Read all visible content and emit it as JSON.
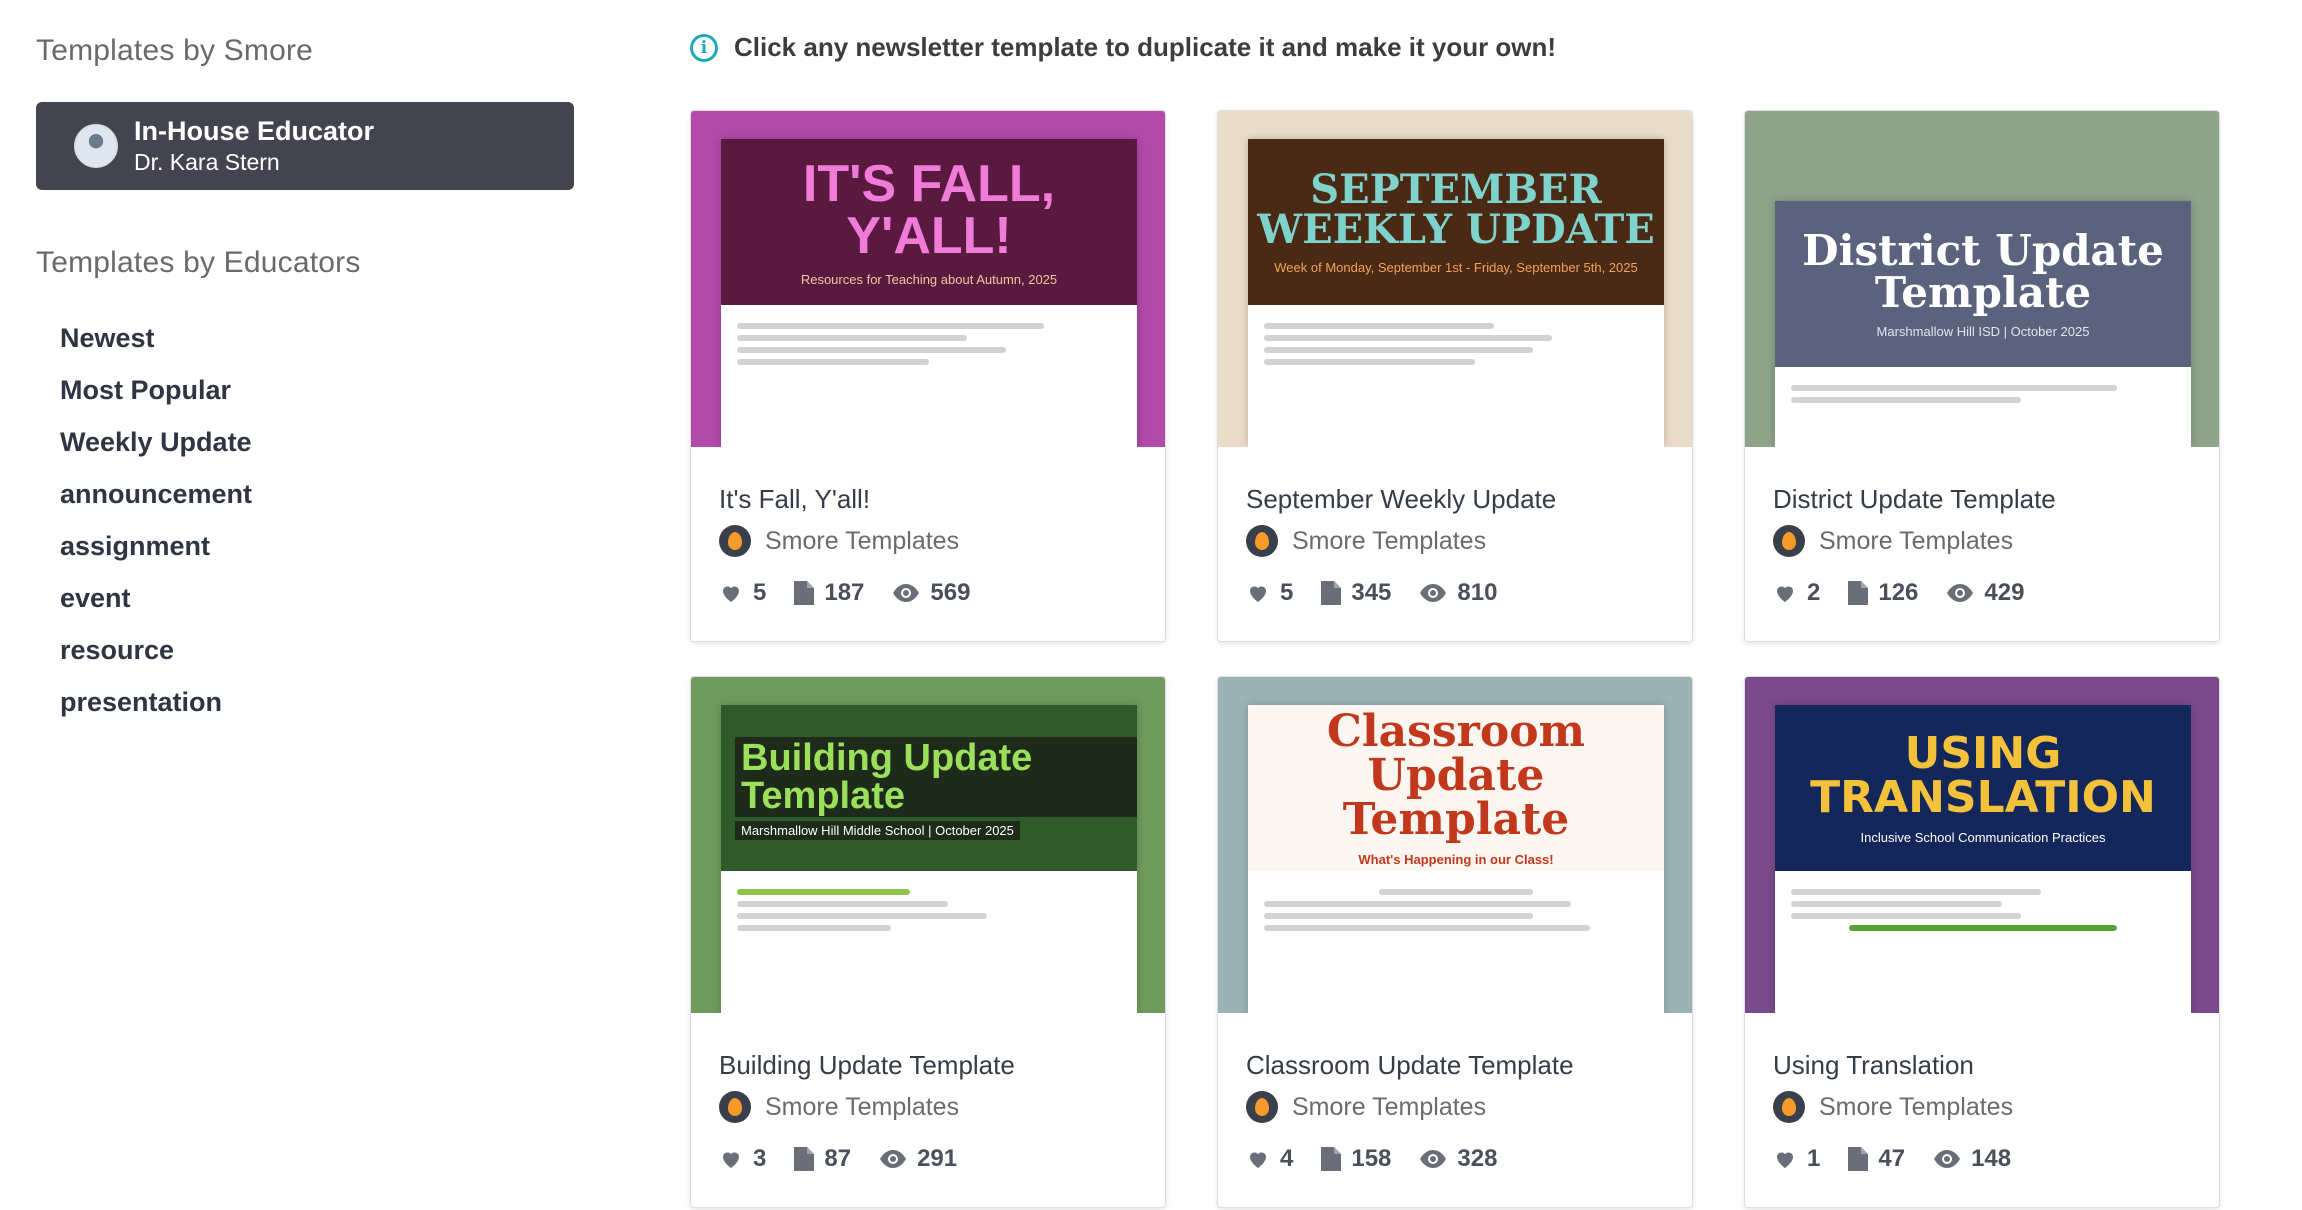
{
  "sidebar": {
    "smore_heading": "Templates by Smore",
    "featured": {
      "title": "In-House Educator",
      "subtitle": "Dr. Kara Stern"
    },
    "educators_heading": "Templates by Educators",
    "categories": [
      "Newest",
      "Most Popular",
      "Weekly Update",
      "announcement",
      "assignment",
      "event",
      "resource",
      "presentation"
    ]
  },
  "banner": {
    "icon": "info-icon",
    "text": "Click any newsletter template to duplicate it and make it your own!"
  },
  "cards": [
    {
      "title": "It's Fall, Y'all!",
      "author": "Smore Templates",
      "likes": "5",
      "copies": "187",
      "views": "569",
      "thumb": {
        "title": "IT'S FALL, Y'ALL!",
        "subtitle": "Resources for Teaching about Autumn, 2025",
        "bg": "#5a1a3f",
        "fg": "#f07bd9",
        "outer": "#b14aa8"
      }
    },
    {
      "title": "September Weekly Update",
      "author": "Smore Templates",
      "likes": "5",
      "copies": "345",
      "views": "810",
      "thumb": {
        "title": "SEPTEMBER WEEKLY UPDATE",
        "subtitle": "Week of Monday, September 1st - Friday, September 5th, 2025",
        "bg": "#4a2a14",
        "fg": "#7fd3cd",
        "outer": "#e9dcc8"
      }
    },
    {
      "title": "District Update Template",
      "author": "Smore Templates",
      "likes": "2",
      "copies": "126",
      "views": "429",
      "thumb": {
        "title": "District Update Template",
        "subtitle": "Marshmallow Hill ISD | October 2025",
        "bg": "#5a627d",
        "fg": "#ffffff",
        "outer": "#8ea38a"
      }
    },
    {
      "title": "Building Update Template",
      "author": "Smore Templates",
      "likes": "3",
      "copies": "87",
      "views": "291",
      "thumb": {
        "title": "Building Update Template",
        "subtitle": "Marshmallow Hill Middle School | October 2025",
        "bg": "#2f5a2a",
        "fg": "#9be05a",
        "outer": "#6f9a5e"
      }
    },
    {
      "title": "Classroom Update Template",
      "author": "Smore Templates",
      "likes": "4",
      "copies": "158",
      "views": "328",
      "thumb": {
        "title": "Classroom Update Template",
        "subtitle": "What's Happening in our Class!",
        "bg": "#fbf6ef",
        "fg": "#c2381d",
        "outer": "#9bb3b5"
      }
    },
    {
      "title": "Using Translation",
      "author": "Smore Templates",
      "likes": "1",
      "copies": "47",
      "views": "148",
      "thumb": {
        "title": "USING TRANSLATION",
        "subtitle": "Inclusive School Communication Practices",
        "bg": "#14275b",
        "fg": "#f3c23a",
        "outer": "#7b4a8a"
      }
    }
  ]
}
